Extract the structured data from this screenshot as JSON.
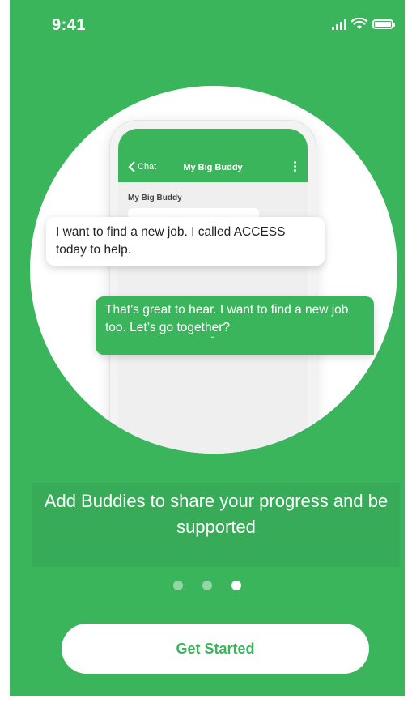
{
  "status_bar": {
    "time": "9:41",
    "icons": [
      "signal-icon",
      "wifi-icon",
      "battery-icon"
    ]
  },
  "illustration": {
    "phone": {
      "back_label": "Chat",
      "title": "My Big Buddy",
      "section_label": "My Big Buddy"
    },
    "messages": [
      {
        "from": "other",
        "text": "I want to find a new job. I called ACCESS today to help."
      },
      {
        "from": "self",
        "text": "That’s great to hear. I want to find a new job too. Let’s go together?"
      }
    ]
  },
  "caption": "Add Buddies to share your progress and be supported",
  "pager": {
    "count": 3,
    "active_index": 2
  },
  "cta": {
    "label": "Get Started"
  },
  "colors": {
    "brand": "#3ab55c",
    "white": "#ffffff"
  }
}
